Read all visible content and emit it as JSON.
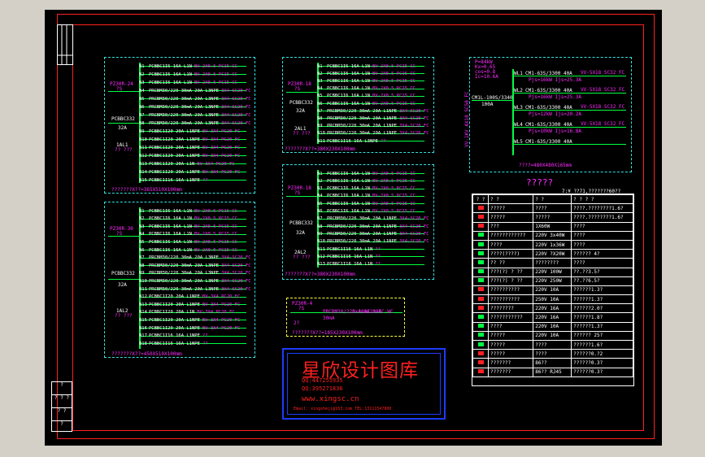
{
  "watermark": {
    "title": "星欣设计图库",
    "qq1": "QQ:447255935",
    "qq2": "QQ:395271836",
    "url": "www.xingsc.cn",
    "footer": "Email: xingsheji@163.com  TEL:13111547800"
  },
  "panels": {
    "p1": {
      "label_in": "PZ30R-24",
      "breaker": "PCBBC332",
      "breaker_amp": "32A",
      "label_io": "1AL1",
      "footer": "???????X??=365X510X100mm",
      "rows": [
        [
          "N1",
          "PCBBC1I6 16A L1N",
          "BV-2X0.5 PC15 CC"
        ],
        [
          "N2",
          "PCBBC1I6 16A L1N",
          "BV-2X0.5 PC15 CC"
        ],
        [
          "N3",
          "PCBBC1I6 16A L1N",
          "BV-2X0.5 PC15 CC"
        ],
        [
          "N4",
          "PRCBM30/220 30mA 20A L3NPE",
          "3X4-SC20 FC"
        ],
        [
          "N5",
          "PRCBM30/220 30mA 20A L3NPE",
          "3X4-SC20 FC"
        ],
        [
          "N6",
          "PRCBM30/220 30mA 20A L3NPE",
          "3X4-SC20 FC"
        ],
        [
          "N7",
          "PRCBM30/220 30mA 20A L3NPE",
          "3X4-SC20 FC"
        ],
        [
          "N8",
          "PRCBM30/220 30mA 20A L3NPE",
          "3X4-SC20 FC"
        ],
        [
          "N9",
          "PCBBC1I20 20A L1NPE",
          "BV-3X4 PC20 FC"
        ],
        [
          "N10",
          "PCBBC1I20 20A L1NPE",
          "BV-3X4 PC20 FC"
        ],
        [
          "N11",
          "PCBBC1I20 20A L1NPE",
          "BV-3X4 PC20 FC"
        ],
        [
          "N12",
          "PCBBC1I20 20A L1NPE",
          "BV-3X4 PC20 FC"
        ],
        [
          "N13",
          "PCBBC1I20 20A L1N",
          "BV-3X4 PC20 FC"
        ],
        [
          "N14",
          "PCBBC1I20 20A L1NPE",
          "BV-3X4 PC20 FC"
        ],
        [
          "N15",
          "PCBBC1I16 16A L1NPE",
          "??"
        ]
      ]
    },
    "p2": {
      "label_in": "PZ30R-30",
      "breaker": "PCBBC332",
      "breaker_amp": "32A",
      "label_io": "1AL2",
      "footer": "???????X??=450X510X100mm",
      "rows": [
        [
          "N1",
          "PCBBC1I6 16A L1N",
          "BV-2X0.5 PC15 CC"
        ],
        [
          "N2",
          "PCBBC1I6 16A L1N",
          "BV-2X0.5 PC15 CC"
        ],
        [
          "N3",
          "PCBBC1I6 16A L1N",
          "BV-2X0.5 PC15 CC"
        ],
        [
          "N4",
          "PCBBC1I6 16A L1N",
          "BV-2X0.5 PC15 CC"
        ],
        [
          "N5",
          "PCBBC1I6 16A L1N",
          "BV-2X0.5 PC15 CC"
        ],
        [
          "N6",
          "PCBBC1I6 16A L1N",
          "BV-2X0.5 PC15 CC"
        ],
        [
          "N7",
          "PRCBM30/220 30mA 20A L3NPE",
          "3X4-SC20 FC"
        ],
        [
          "N8",
          "PRCBM30/220 30mA 20A L3NPE",
          "3X4-SC20 FC"
        ],
        [
          "N9",
          "PRCBM30/220 30mA 20A L3NPE",
          "3X4-SC20 FC"
        ],
        [
          "N10",
          "PRCBM30/220 30mA 20A L3NPE",
          "3X4-SC20 FC"
        ],
        [
          "N11",
          "PRCBM30/220 30mA 20A L3NPE",
          "3X4-SC20 FC"
        ],
        [
          "N12",
          "PCBBC1I20 20A L1NPE",
          "BV-3X4 PC20 FC"
        ],
        [
          "N13",
          "PCBBC1I20 20A L1NPE",
          "BV-3X4 PC20 FC"
        ],
        [
          "N14",
          "PCBBC1I20 20A L1N",
          "BV-3X4 PC20 FC"
        ],
        [
          "N15",
          "PCBBC1I20 20A L1NPE",
          "BV-3X4 PC20 FC"
        ],
        [
          "N16",
          "PCBBC1I20 20A L1NPE",
          "BV-3X4 PC20 FC"
        ],
        [
          "N17",
          "PCBBC1I16 16A L1NPE",
          "??"
        ],
        [
          "N18",
          "PCBBC1I16 16A L1NPE",
          "??"
        ]
      ]
    },
    "p3": {
      "label_in": "PZ30R-18",
      "breaker": "PCBBC332",
      "breaker_amp": "32A",
      "label_io": "2AL1",
      "footer": "???????X??=380X230X100mm",
      "rows": [
        [
          "N1",
          "PCBBC1I6 16A L1N",
          "BV-2X0.5 PC15 CC"
        ],
        [
          "N2",
          "PCBBC1I6 16A L1N",
          "BV-2X0.5 PC15 CC"
        ],
        [
          "N3",
          "PCBBC1I6 16A L1N",
          "BV-2X0.5 PC15 CC"
        ],
        [
          "N4",
          "PCBBC1I6 16A L1N",
          "BV-2X0.5 PC15 CC"
        ],
        [
          "N5",
          "PCBBC1I6 16A L1N",
          "BV-2X0.5 PC15 CC"
        ],
        [
          "N6",
          "PCBBC1I6 16A L1N",
          "BV-2X0.5 PC15 CC"
        ],
        [
          "N7",
          "PRCBM30/220 30mA 20A L1NPE",
          "3X4-SC20 FC"
        ],
        [
          "N8",
          "PRCBM30/220 30mA 20A L1NPE",
          "3X4-SC20 FC"
        ],
        [
          "N9",
          "PRCBM30/220 30mA 20A L1NPE",
          "3X4-SC20 FC"
        ],
        [
          "N10",
          "PRCBM30/220 30mA 20A L1NPE",
          "3X4-SC20 FC"
        ],
        [
          "N11",
          "PCBBC1I16 16A L3NPE",
          "??"
        ]
      ]
    },
    "p4": {
      "label_in": "PZ30R-18",
      "breaker": "PCBBC332",
      "breaker_amp": "32A",
      "label_io": "2AL2",
      "footer": "???????X??=380X230X100mm",
      "rows": [
        [
          "N1",
          "PCBBC1I6 16A L1N",
          "BV-2X0.5 PC15 CC"
        ],
        [
          "N2",
          "PCBBC1I6 16A L1N",
          "BV-2X0.5 PC15 CC"
        ],
        [
          "N3",
          "PCBBC1I6 16A L1N",
          "BV-2X0.5 PC15 CC"
        ],
        [
          "N4",
          "PCBBC1I6 16A L1N",
          "BV-2X0.5 PC15 CC"
        ],
        [
          "N5",
          "PCBBC1I6 16A L1N",
          "BV-2X0.5 PC15 CC"
        ],
        [
          "N6",
          "PCBBC1I6 16A L1N",
          "BV-2X0.5 PC15 CC"
        ],
        [
          "N7",
          "PRCBM30/220 30mA 20A L1NPE",
          "3X4-SC20 FC"
        ],
        [
          "N8",
          "PRCBM30/220 30mA 20A L1NPE",
          "3X4-SC20 FC"
        ],
        [
          "N9",
          "PRCBM30/220 30mA 20A L1NPE",
          "3X4-SC20 FC"
        ],
        [
          "N10",
          "PRCBM30/220 30mA 20A L1NPE",
          "3X4-SC20 FC"
        ],
        [
          "N11",
          "PCBBC1I16 16A L1N",
          "??"
        ],
        [
          "N12",
          "PCBBC1I16 16A L1N",
          "??"
        ],
        [
          "N13",
          "PCBBC1I16 16A L1N",
          "??"
        ]
      ]
    },
    "p5": {
      "label_in": "PZ30R-4",
      "label_io": "2?",
      "circuit": "PRCBM30/220 30mA 20A",
      "wire": "3x4-SC20-FC-WC",
      "footer": "???????X??=185X230X100mm"
    },
    "p6": {
      "top1": "P=84kW",
      "top2": "Kx=0.65",
      "top3": "cos=0.8",
      "top4": "Ic=10.6A",
      "main": "CM1L-100S/3340",
      "main_amp": "100A",
      "cable": "VV-1KV 4X10 SC50 FC",
      "footer": "????=480X480X165mm",
      "rows": [
        [
          "WL1",
          "CM1-63S/3300",
          "40A",
          "VV-5X18 SC32 FC",
          "Pjs=16kW Ijs=25.3A"
        ],
        [
          "WL2",
          "CM1-63S/3300",
          "40A",
          "VV-5X18 SC32 FC",
          "Pjs=16kW Ijs=25.3A"
        ],
        [
          "WL3",
          "CM1-63S/3300",
          "40A",
          "VV-5X18 SC32 FC",
          "Pjs=12kW Ijs=20.2A"
        ],
        [
          "WL4",
          "CM1-63S/3300",
          "40A",
          "VV-5X18 SC32 FC",
          "Pjs=10kW Ijs=16.8A"
        ],
        [
          "WL5",
          "CM1-63S/3300",
          "40A",
          "",
          " "
        ]
      ]
    }
  },
  "legend": {
    "title": "?????",
    "subtitle": "7:¥  ??71,???????60??",
    "headers": [
      "? ?",
      "? ?",
      "? ?",
      "? ? ? ?"
    ],
    "rows": [
      [
        "#ff2020",
        "?????",
        "????",
        "????.????????1.6?"
      ],
      [
        "#ff2020",
        "?????",
        "?????",
        "????.????????1.6?"
      ],
      [
        "#ff2020",
        "???",
        "1X60W",
        "????"
      ],
      [
        "#00ff40",
        "????????????",
        "220V 3x40W",
        "????"
      ],
      [
        "#00ff40",
        "????",
        "220V 1x36W",
        "????"
      ],
      [
        "#00ff40",
        "????(????)",
        "220V ?X20W",
        "?????? 4?"
      ],
      [
        "#00ff40",
        "?? ??",
        "????????",
        "????"
      ],
      [
        "#00ff40",
        "???(?) ? ??",
        "220V 100W",
        "??.??3.5?"
      ],
      [
        "#00ff40",
        "???(?) ? ??",
        "220V 250W",
        "??.??6.5?"
      ],
      [
        "#ff2020",
        "??????????",
        "220V 10A",
        "??????1.3?"
      ],
      [
        "#ff2020",
        "??????????",
        "250V 10A",
        "??????1.3?"
      ],
      [
        "#ff2020",
        "????????",
        "220V 16A",
        "??????2.0?"
      ],
      [
        "#00ff40",
        "???????????",
        "220V 16A",
        "??????1.8?"
      ],
      [
        "#00ff40",
        "????",
        "220V 10A",
        "??????1.3?"
      ],
      [
        "#00ff40",
        "?????",
        "220V 10A",
        "?????? 25?"
      ],
      [
        "#00ff40",
        "?????",
        "????",
        "??????1.6?"
      ],
      [
        "#ff2020",
        "?????",
        "????",
        "??????0.?2"
      ],
      [
        "#ff2020",
        "???????",
        "86??",
        "??????0.3?"
      ],
      [
        "#ff2020",
        "???????",
        "86?? RJ45",
        "??????0.3?"
      ]
    ]
  },
  "titlebox": {
    "rows": [
      "?",
      "? ? ?",
      "? ?",
      "?"
    ]
  }
}
